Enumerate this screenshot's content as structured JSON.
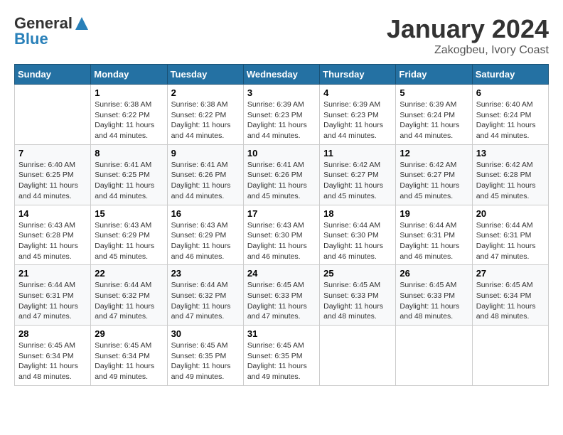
{
  "header": {
    "logo_general": "General",
    "logo_blue": "Blue",
    "month_title": "January 2024",
    "subtitle": "Zakogbeu, Ivory Coast"
  },
  "weekdays": [
    "Sunday",
    "Monday",
    "Tuesday",
    "Wednesday",
    "Thursday",
    "Friday",
    "Saturday"
  ],
  "weeks": [
    [
      {
        "day": "",
        "info": ""
      },
      {
        "day": "1",
        "info": "Sunrise: 6:38 AM\nSunset: 6:22 PM\nDaylight: 11 hours and 44 minutes."
      },
      {
        "day": "2",
        "info": "Sunrise: 6:38 AM\nSunset: 6:22 PM\nDaylight: 11 hours and 44 minutes."
      },
      {
        "day": "3",
        "info": "Sunrise: 6:39 AM\nSunset: 6:23 PM\nDaylight: 11 hours and 44 minutes."
      },
      {
        "day": "4",
        "info": "Sunrise: 6:39 AM\nSunset: 6:23 PM\nDaylight: 11 hours and 44 minutes."
      },
      {
        "day": "5",
        "info": "Sunrise: 6:39 AM\nSunset: 6:24 PM\nDaylight: 11 hours and 44 minutes."
      },
      {
        "day": "6",
        "info": "Sunrise: 6:40 AM\nSunset: 6:24 PM\nDaylight: 11 hours and 44 minutes."
      }
    ],
    [
      {
        "day": "7",
        "info": "Sunrise: 6:40 AM\nSunset: 6:25 PM\nDaylight: 11 hours and 44 minutes."
      },
      {
        "day": "8",
        "info": "Sunrise: 6:41 AM\nSunset: 6:25 PM\nDaylight: 11 hours and 44 minutes."
      },
      {
        "day": "9",
        "info": "Sunrise: 6:41 AM\nSunset: 6:26 PM\nDaylight: 11 hours and 44 minutes."
      },
      {
        "day": "10",
        "info": "Sunrise: 6:41 AM\nSunset: 6:26 PM\nDaylight: 11 hours and 45 minutes."
      },
      {
        "day": "11",
        "info": "Sunrise: 6:42 AM\nSunset: 6:27 PM\nDaylight: 11 hours and 45 minutes."
      },
      {
        "day": "12",
        "info": "Sunrise: 6:42 AM\nSunset: 6:27 PM\nDaylight: 11 hours and 45 minutes."
      },
      {
        "day": "13",
        "info": "Sunrise: 6:42 AM\nSunset: 6:28 PM\nDaylight: 11 hours and 45 minutes."
      }
    ],
    [
      {
        "day": "14",
        "info": "Sunrise: 6:43 AM\nSunset: 6:28 PM\nDaylight: 11 hours and 45 minutes."
      },
      {
        "day": "15",
        "info": "Sunrise: 6:43 AM\nSunset: 6:29 PM\nDaylight: 11 hours and 45 minutes."
      },
      {
        "day": "16",
        "info": "Sunrise: 6:43 AM\nSunset: 6:29 PM\nDaylight: 11 hours and 46 minutes."
      },
      {
        "day": "17",
        "info": "Sunrise: 6:43 AM\nSunset: 6:30 PM\nDaylight: 11 hours and 46 minutes."
      },
      {
        "day": "18",
        "info": "Sunrise: 6:44 AM\nSunset: 6:30 PM\nDaylight: 11 hours and 46 minutes."
      },
      {
        "day": "19",
        "info": "Sunrise: 6:44 AM\nSunset: 6:31 PM\nDaylight: 11 hours and 46 minutes."
      },
      {
        "day": "20",
        "info": "Sunrise: 6:44 AM\nSunset: 6:31 PM\nDaylight: 11 hours and 47 minutes."
      }
    ],
    [
      {
        "day": "21",
        "info": "Sunrise: 6:44 AM\nSunset: 6:31 PM\nDaylight: 11 hours and 47 minutes."
      },
      {
        "day": "22",
        "info": "Sunrise: 6:44 AM\nSunset: 6:32 PM\nDaylight: 11 hours and 47 minutes."
      },
      {
        "day": "23",
        "info": "Sunrise: 6:44 AM\nSunset: 6:32 PM\nDaylight: 11 hours and 47 minutes."
      },
      {
        "day": "24",
        "info": "Sunrise: 6:45 AM\nSunset: 6:33 PM\nDaylight: 11 hours and 47 minutes."
      },
      {
        "day": "25",
        "info": "Sunrise: 6:45 AM\nSunset: 6:33 PM\nDaylight: 11 hours and 48 minutes."
      },
      {
        "day": "26",
        "info": "Sunrise: 6:45 AM\nSunset: 6:33 PM\nDaylight: 11 hours and 48 minutes."
      },
      {
        "day": "27",
        "info": "Sunrise: 6:45 AM\nSunset: 6:34 PM\nDaylight: 11 hours and 48 minutes."
      }
    ],
    [
      {
        "day": "28",
        "info": "Sunrise: 6:45 AM\nSunset: 6:34 PM\nDaylight: 11 hours and 48 minutes."
      },
      {
        "day": "29",
        "info": "Sunrise: 6:45 AM\nSunset: 6:34 PM\nDaylight: 11 hours and 49 minutes."
      },
      {
        "day": "30",
        "info": "Sunrise: 6:45 AM\nSunset: 6:35 PM\nDaylight: 11 hours and 49 minutes."
      },
      {
        "day": "31",
        "info": "Sunrise: 6:45 AM\nSunset: 6:35 PM\nDaylight: 11 hours and 49 minutes."
      },
      {
        "day": "",
        "info": ""
      },
      {
        "day": "",
        "info": ""
      },
      {
        "day": "",
        "info": ""
      }
    ]
  ]
}
